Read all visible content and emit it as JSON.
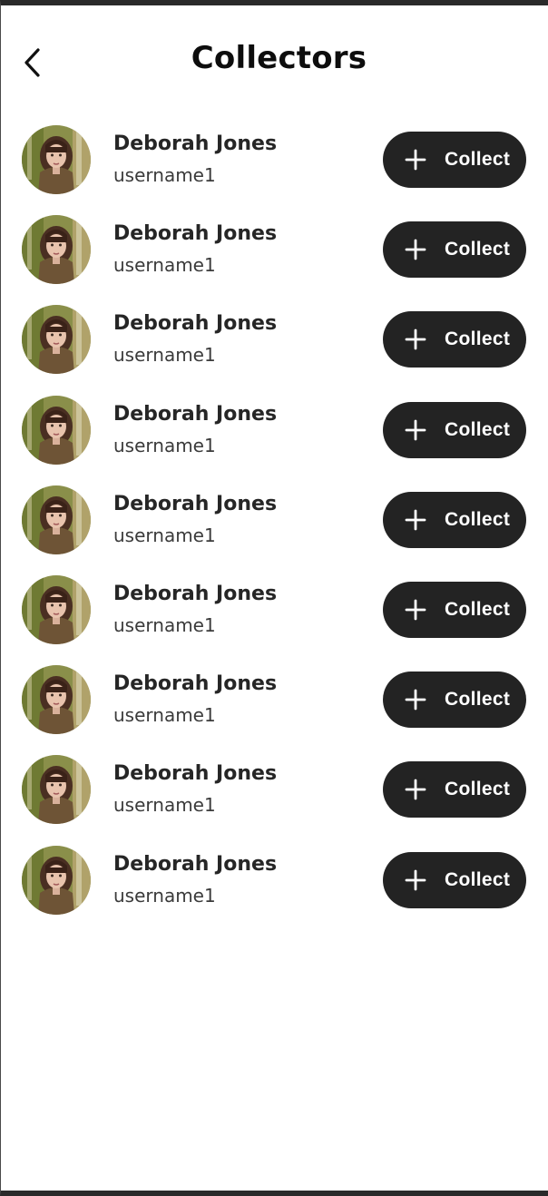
{
  "header": {
    "title": "Collectors",
    "back_icon": "chevron-left-icon"
  },
  "colors": {
    "button_bg": "#232323",
    "button_text": "#ffffff",
    "title_text": "#0d0d0d"
  },
  "collectors": [
    {
      "name": "Deborah Jones",
      "username": "username1",
      "button_label": "Collect",
      "button_icon": "plus-icon"
    },
    {
      "name": "Deborah Jones",
      "username": "username1",
      "button_label": "Collect",
      "button_icon": "plus-icon"
    },
    {
      "name": "Deborah Jones",
      "username": "username1",
      "button_label": "Collect",
      "button_icon": "plus-icon"
    },
    {
      "name": "Deborah Jones",
      "username": "username1",
      "button_label": "Collect",
      "button_icon": "plus-icon"
    },
    {
      "name": "Deborah Jones",
      "username": "username1",
      "button_label": "Collect",
      "button_icon": "plus-icon"
    },
    {
      "name": "Deborah Jones",
      "username": "username1",
      "button_label": "Collect",
      "button_icon": "plus-icon"
    },
    {
      "name": "Deborah Jones",
      "username": "username1",
      "button_label": "Collect",
      "button_icon": "plus-icon"
    },
    {
      "name": "Deborah Jones",
      "username": "username1",
      "button_label": "Collect",
      "button_icon": "plus-icon"
    },
    {
      "name": "Deborah Jones",
      "username": "username1",
      "button_label": "Collect",
      "button_icon": "plus-icon"
    }
  ]
}
